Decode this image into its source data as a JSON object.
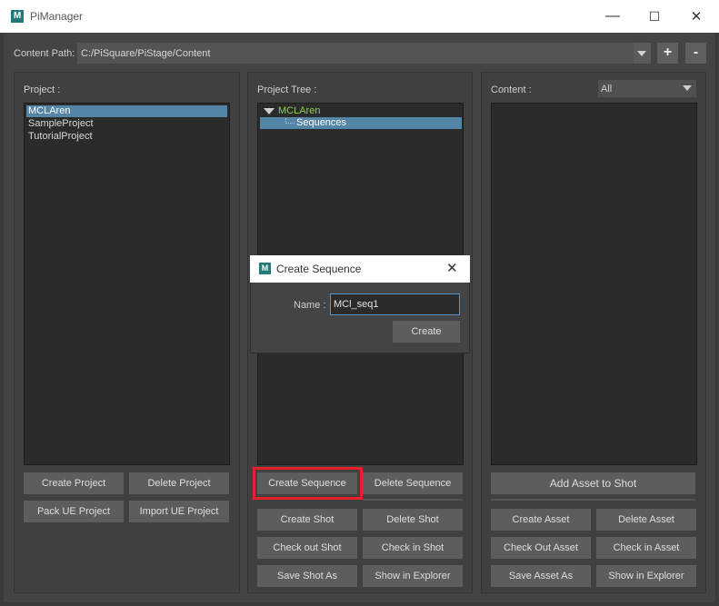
{
  "window": {
    "title": "PiManager",
    "minimize": "—",
    "maximize": "☐",
    "close": "✕"
  },
  "content_path": {
    "label": "Content Path:",
    "value": "C:/PiSquare/PiStage/Content",
    "add": "+",
    "remove": "-"
  },
  "project_panel": {
    "label": "Project :",
    "items": [
      "MCLAren",
      "SampleProject",
      "TutorialProject"
    ],
    "selected": "MCLAren",
    "buttons": [
      "Create Project",
      "Delete Project",
      "Pack UE Project",
      "Import UE Project"
    ]
  },
  "tree_panel": {
    "label": "Project Tree :",
    "root": "MCLAren",
    "child": "Sequences",
    "buttons": [
      "Create Sequence",
      "Delete Sequence",
      "Create Shot",
      "Delete Shot",
      "Check out Shot",
      "Check in Shot",
      "Save Shot As",
      "Show in Explorer"
    ]
  },
  "content_panel": {
    "label": "Content :",
    "filter": "All",
    "buttons": [
      "Add Asset to Shot",
      "Create Asset",
      "Delete Asset",
      "Check Out Asset",
      "Check in Asset",
      "Save Asset As",
      "Show in Explorer"
    ]
  },
  "dialog": {
    "title": "Create Sequence",
    "name_label": "Name :",
    "name_value": "MCl_seq1",
    "create": "Create",
    "close": "✕"
  },
  "colors": {
    "selection": "#5285a6",
    "tree_root": "#8fce4a",
    "highlight": "#e8202c",
    "accent_icon": "#1f7a78"
  }
}
